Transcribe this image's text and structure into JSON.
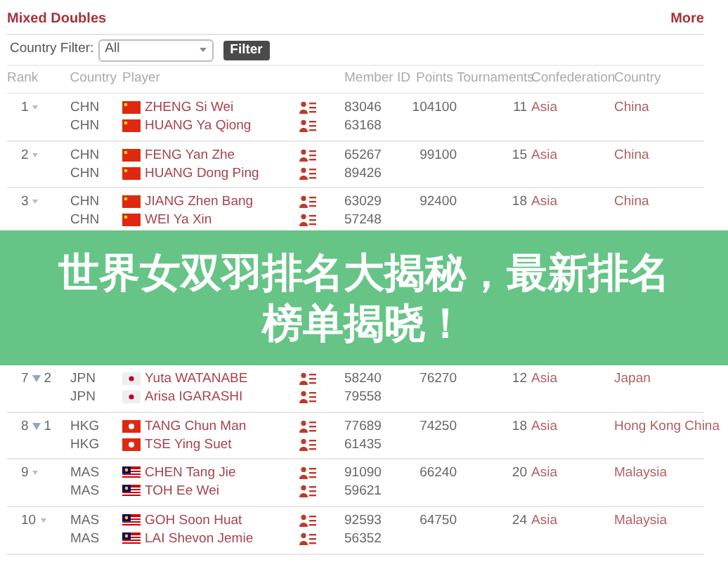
{
  "header": {
    "title": "Mixed Doubles",
    "more": "More"
  },
  "filter": {
    "label": "Country Filter:",
    "value": "All",
    "button": "Filter"
  },
  "table": {
    "columns": [
      "Rank",
      "Country",
      "Player",
      "Member ID",
      "Points",
      "Tournaments",
      "Confederation",
      "Country"
    ],
    "rows": [
      {
        "rank": "1",
        "movement": {
          "kind": "none"
        },
        "points": "104100",
        "tournaments": "11",
        "confederation": "Asia",
        "country_name": "China",
        "players": [
          {
            "country": "CHN",
            "flag": {
              "kind": "china"
            },
            "name": "ZHENG Si Wei",
            "member_id": "83046"
          },
          {
            "country": "CHN",
            "flag": {
              "kind": "china"
            },
            "name": "HUANG Ya Qiong",
            "member_id": "63168"
          }
        ]
      },
      {
        "rank": "2",
        "movement": {
          "kind": "none"
        },
        "points": "99100",
        "tournaments": "15",
        "confederation": "Asia",
        "country_name": "China",
        "players": [
          {
            "country": "CHN",
            "flag": {
              "kind": "china"
            },
            "name": "FENG Yan Zhe",
            "member_id": "65267"
          },
          {
            "country": "CHN",
            "flag": {
              "kind": "china"
            },
            "name": "HUANG Dong Ping",
            "member_id": "89426"
          }
        ]
      },
      {
        "rank": "3",
        "movement": {
          "kind": "none"
        },
        "points": "92400",
        "tournaments": "18",
        "confederation": "Asia",
        "country_name": "China",
        "players": [
          {
            "country": "CHN",
            "flag": {
              "kind": "china"
            },
            "name": "JIANG Zhen Bang",
            "member_id": "63029"
          },
          {
            "country": "CHN",
            "flag": {
              "kind": "china"
            },
            "name": "WEI Ya Xin",
            "member_id": "57248"
          }
        ]
      },
      {
        "rank": "7",
        "movement": {
          "kind": "down",
          "by": "2"
        },
        "points": "76270",
        "tournaments": "12",
        "confederation": "Asia",
        "country_name": "Japan",
        "players": [
          {
            "country": "JPN",
            "flag": {
              "kind": "japan"
            },
            "name": "Yuta WATANABE",
            "member_id": "58240"
          },
          {
            "country": "JPN",
            "flag": {
              "kind": "japan"
            },
            "name": "Arisa IGARASHI",
            "member_id": "79558"
          }
        ]
      },
      {
        "rank": "8",
        "movement": {
          "kind": "down",
          "by": "1"
        },
        "points": "74250",
        "tournaments": "18",
        "confederation": "Asia",
        "country_name": "Hong Kong China",
        "players": [
          {
            "country": "HKG",
            "flag": {
              "kind": "hongkong"
            },
            "name": "TANG Chun Man",
            "member_id": "77689"
          },
          {
            "country": "HKG",
            "flag": {
              "kind": "hongkong"
            },
            "name": "TSE Ying Suet",
            "member_id": "61435"
          }
        ]
      },
      {
        "rank": "9",
        "movement": {
          "kind": "none"
        },
        "points": "66240",
        "tournaments": "20",
        "confederation": "Asia",
        "country_name": "Malaysia",
        "players": [
          {
            "country": "MAS",
            "flag": {
              "kind": "malaysia"
            },
            "name": "CHEN Tang Jie",
            "member_id": "91090"
          },
          {
            "country": "MAS",
            "flag": {
              "kind": "malaysia"
            },
            "name": "TOH Ee Wei",
            "member_id": "59621"
          }
        ]
      },
      {
        "rank": "10",
        "movement": {
          "kind": "none"
        },
        "points": "64750",
        "tournaments": "24",
        "confederation": "Asia",
        "country_name": "Malaysia",
        "players": [
          {
            "country": "MAS",
            "flag": {
              "kind": "malaysia"
            },
            "name": "GOH Soon Huat",
            "member_id": "92593"
          },
          {
            "country": "MAS",
            "flag": {
              "kind": "malaysia"
            },
            "name": "LAI Shevon Jemie",
            "member_id": "56352"
          }
        ]
      }
    ]
  },
  "banner": {
    "title": "世界女双羽排名大揭秘，最新排名榜单揭晓！"
  }
}
